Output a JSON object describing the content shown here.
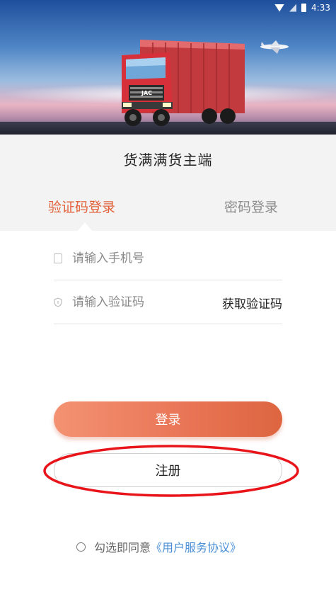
{
  "status_bar": {
    "time": "4:33"
  },
  "header": {
    "title": "货满满货主端"
  },
  "tabs": [
    {
      "label": "验证码登录",
      "active": true
    },
    {
      "label": "密码登录",
      "active": false
    }
  ],
  "form": {
    "phone_placeholder": "请输入手机号",
    "phone_value": "",
    "code_placeholder": "请输入验证码",
    "code_value": "",
    "get_code_label": "获取验证码"
  },
  "buttons": {
    "login_label": "登录",
    "register_label": "注册"
  },
  "agreement": {
    "prefix": "勾选即同意",
    "link_text": "《用户服务协议》",
    "checked": false
  },
  "truck": {
    "grille_text": "JAC"
  },
  "colors": {
    "accent": "#e2623b",
    "link": "#4a8fd6",
    "highlight_ring": "#e8141a"
  }
}
